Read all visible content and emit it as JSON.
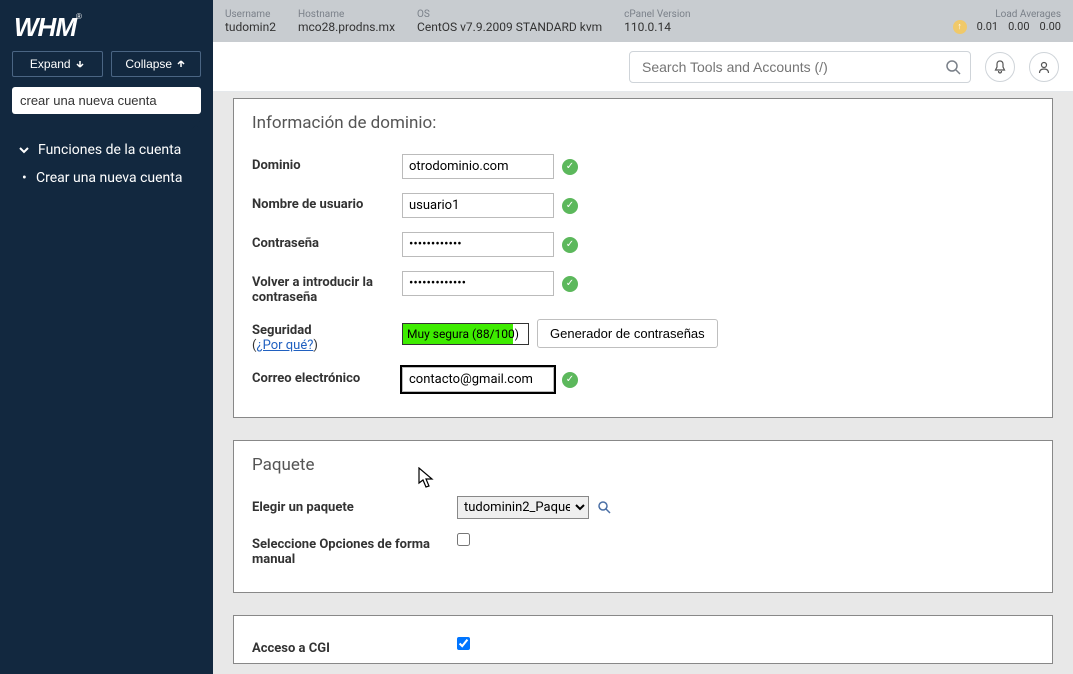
{
  "sidebar": {
    "expand": "Expand",
    "collapse": "Collapse",
    "search_value": "crear una nueva cuenta",
    "section_title": "Funciones de la cuenta",
    "nav_item": "Crear una nueva cuenta"
  },
  "topbar": {
    "username_lbl": "Username",
    "username_val": "tudomin2",
    "hostname_lbl": "Hostname",
    "hostname_val": "mco28.prodns.mx",
    "os_lbl": "OS",
    "os_val": "CentOS v7.9.2009 STANDARD kvm",
    "cpanel_lbl": "cPanel Version",
    "cpanel_val": "110.0.14",
    "load_lbl": "Load Averages",
    "load1": "0.01",
    "load2": "0.00",
    "load3": "0.00"
  },
  "searchbar": {
    "placeholder": "Search Tools and Accounts (/)"
  },
  "domain_panel": {
    "title": "Información de dominio:",
    "domain_lbl": "Dominio",
    "domain_val": "otrodominio.com",
    "username_lbl": "Nombre de usuario",
    "username_val": "usuario1",
    "password_lbl": "Contraseña",
    "password_val": "••••••••••••",
    "repassword_lbl": "Volver a introducir la contraseña",
    "repassword_val": "•••••••••••••",
    "security_lbl": "Seguridad",
    "why_link": "¿Por qué?",
    "strength_text": "Muy segura (88/100)",
    "gen_btn": "Generador de contraseñas",
    "email_lbl": "Correo electrónico",
    "email_val": "contacto@gmail.com"
  },
  "package_panel": {
    "title": "Paquete",
    "choose_lbl": "Elegir un paquete",
    "choose_val": "tudominin2_Paque",
    "manual_lbl": "Seleccione Opciones de forma manual"
  },
  "cgi_panel": {
    "cgi_lbl": "Acceso a CGI"
  }
}
